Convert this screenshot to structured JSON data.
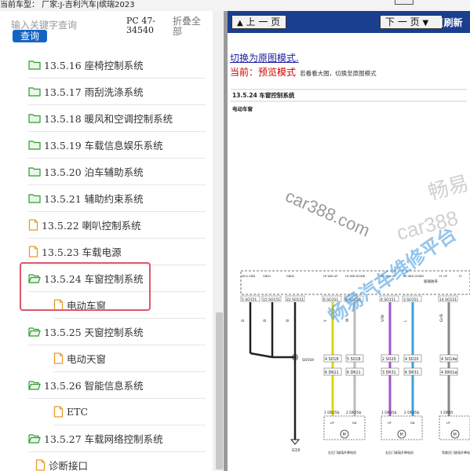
{
  "top_bar": {
    "text": "当前车型：  厂家:J-吉利汽车|缤瑞2023"
  },
  "search": {
    "placeholder": "输入关键字查询",
    "query_button": "查询"
  },
  "toolbar": {
    "pc_code": "PC 47-34540",
    "collapse_all": "折叠全部"
  },
  "tree": {
    "items": [
      {
        "label": "13.5.16 座椅控制系统",
        "icon": "folder-icon"
      },
      {
        "label": "13.5.17 雨刮洗涤系统",
        "icon": "folder-icon"
      },
      {
        "label": "13.5.18 暖风和空调控制系统",
        "icon": "folder-icon"
      },
      {
        "label": "13.5.19 车载信息娱乐系统",
        "icon": "folder-icon"
      },
      {
        "label": "13.5.20 泊车辅助系统",
        "icon": "folder-icon"
      },
      {
        "label": "13.5.21 辅助约束系统",
        "icon": "folder-icon"
      },
      {
        "label": "13.5.22 喇叭控制系统",
        "icon": "document-icon"
      },
      {
        "label": "13.5.23 车载电源",
        "icon": "document-icon"
      },
      {
        "label": "13.5.24 车窗控制系统",
        "icon": "folder-open-icon"
      },
      {
        "label": "电动车窗",
        "icon": "document-icon"
      },
      {
        "label": "13.5.25 天窗控制系统",
        "icon": "folder-open-icon"
      },
      {
        "label": "电动天窗",
        "icon": "document-icon"
      },
      {
        "label": "13.5.26 智能信息系统",
        "icon": "folder-open-icon"
      },
      {
        "label": "ETC",
        "icon": "document-icon"
      },
      {
        "label": "13.5.27 车载网络控制系统",
        "icon": "folder-open-icon"
      },
      {
        "label": "诊断接口",
        "icon": "document-icon"
      }
    ]
  },
  "viewer": {
    "prev_page": "上 一 页",
    "next_page": "下 一 页",
    "refresh": "[刷新",
    "switch_link": "切换为原图模式.",
    "current_label": "当前：预览模式",
    "current_hint": "若看看大图，切换至原图模式"
  },
  "diagram": {
    "section_title": "13.5.24 车窗控制系统",
    "subtitle": "电动车窗",
    "header_right": "玻璃防夹",
    "top_labels": [
      "MCU GND",
      "GND1",
      "GND2",
      "LR WIN UP",
      "LR WIN DOWN",
      "RR WIN UP",
      "RR WIN DOWN",
      "FL UP",
      "FL"
    ],
    "pin_labels": [
      "5 SO151",
      "15 SO151",
      "22 SO151",
      "6 SO151",
      "8 SO151",
      "4 SO151",
      "3 SO151",
      "14 SO151"
    ],
    "wire_colors": [
      "B",
      "B",
      "B",
      "Y",
      "W",
      "V/W",
      "L",
      "Gr/B"
    ],
    "mid_labels": [
      "4 SO18",
      "5 SO18",
      "2 SO20",
      "4 SO20",
      "4 SO14e"
    ],
    "dr_labels": [
      "6 DR21",
      "6 DR21",
      "3 DR31",
      "6 DR31",
      "4 DR01e"
    ],
    "bottom_pins": [
      "1 DR25b",
      "2 DR25b",
      "1 DR35b",
      "2 DR35b",
      "1 DR05"
    ],
    "junction_label": "SO5S9",
    "ground_label": "G19",
    "component_labels": [
      "左后门玻璃升降电机",
      "右后门玻璃升降电机",
      "驾驶员门玻璃升降电机"
    ],
    "motor_pins": [
      "UP",
      "DN",
      "UP",
      "DN",
      "UP"
    ],
    "wire_hex": {
      "black": "#222222",
      "yellow": "#e3d21a",
      "white": "#bbbbbb",
      "violet": "#a255c8",
      "blue": "#3ba3dd",
      "grey": "#888888"
    }
  },
  "watermarks": {
    "site": "car388.com",
    "brand": "畅易",
    "car": "car388",
    "platform": "畅易汽车维修平台"
  },
  "colors": {
    "accent_blue": "#1565c0",
    "nav_blue": "#1a3f8f",
    "highlight": "#e0566a",
    "folder_green": "#2e9b2e",
    "doc_orange": "#e79a2a"
  }
}
